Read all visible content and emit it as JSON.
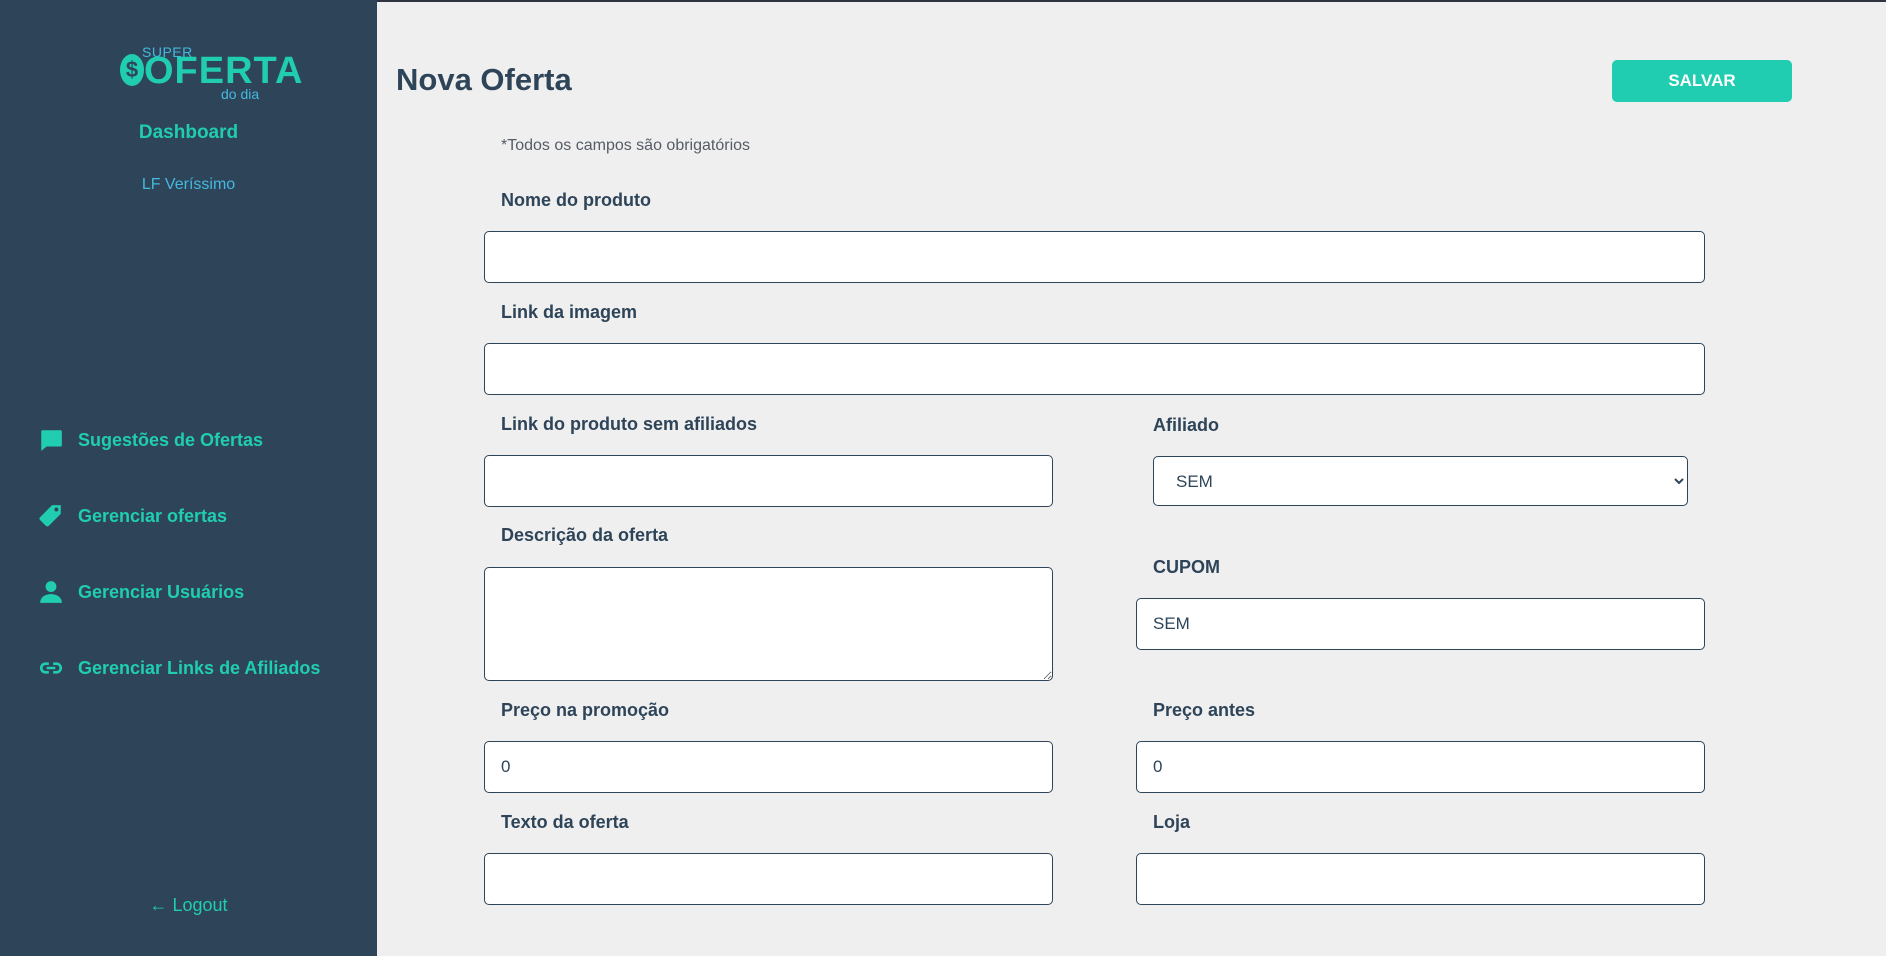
{
  "brand": {
    "super": "SUPER",
    "coin": "$",
    "oferta": "OFERTA",
    "dodia": "do dia"
  },
  "sidebar": {
    "dashboard": "Dashboard",
    "user": "LF Veríssimo",
    "items": [
      {
        "label": "Sugestões de Ofertas",
        "icon": "chat-bubble-icon"
      },
      {
        "label": "Gerenciar ofertas",
        "icon": "price-tag-icon"
      },
      {
        "label": "Gerenciar Usuários",
        "icon": "person-icon"
      },
      {
        "label": "Gerenciar Links de Afiliados",
        "icon": "link-icon"
      }
    ],
    "logout": "← Logout"
  },
  "header": {
    "title": "Nova Oferta",
    "save_label": "SALVAR"
  },
  "form": {
    "note": "*Todos os campos são obrigatórios",
    "nome": {
      "label": "Nome do produto",
      "value": ""
    },
    "imagem": {
      "label": "Link da imagem",
      "value": ""
    },
    "link": {
      "label": "Link do produto sem afiliados",
      "value": ""
    },
    "afiliado": {
      "label": "Afiliado",
      "value": "SEM",
      "options": [
        "SEM"
      ]
    },
    "descricao": {
      "label": "Descrição da oferta",
      "value": ""
    },
    "cupom": {
      "label": "CUPOM",
      "value": "SEM"
    },
    "preco_promo": {
      "label": "Preço na promoção",
      "value": "0"
    },
    "preco_antes": {
      "label": "Preço antes",
      "value": "0"
    },
    "texto": {
      "label": "Texto da oferta",
      "value": ""
    },
    "loja": {
      "label": "Loja",
      "value": ""
    }
  },
  "colors": {
    "sidebar_bg": "#2e4459",
    "accent": "#20cdb0",
    "secondary": "#45b8e0",
    "page_bg": "#efefef"
  }
}
